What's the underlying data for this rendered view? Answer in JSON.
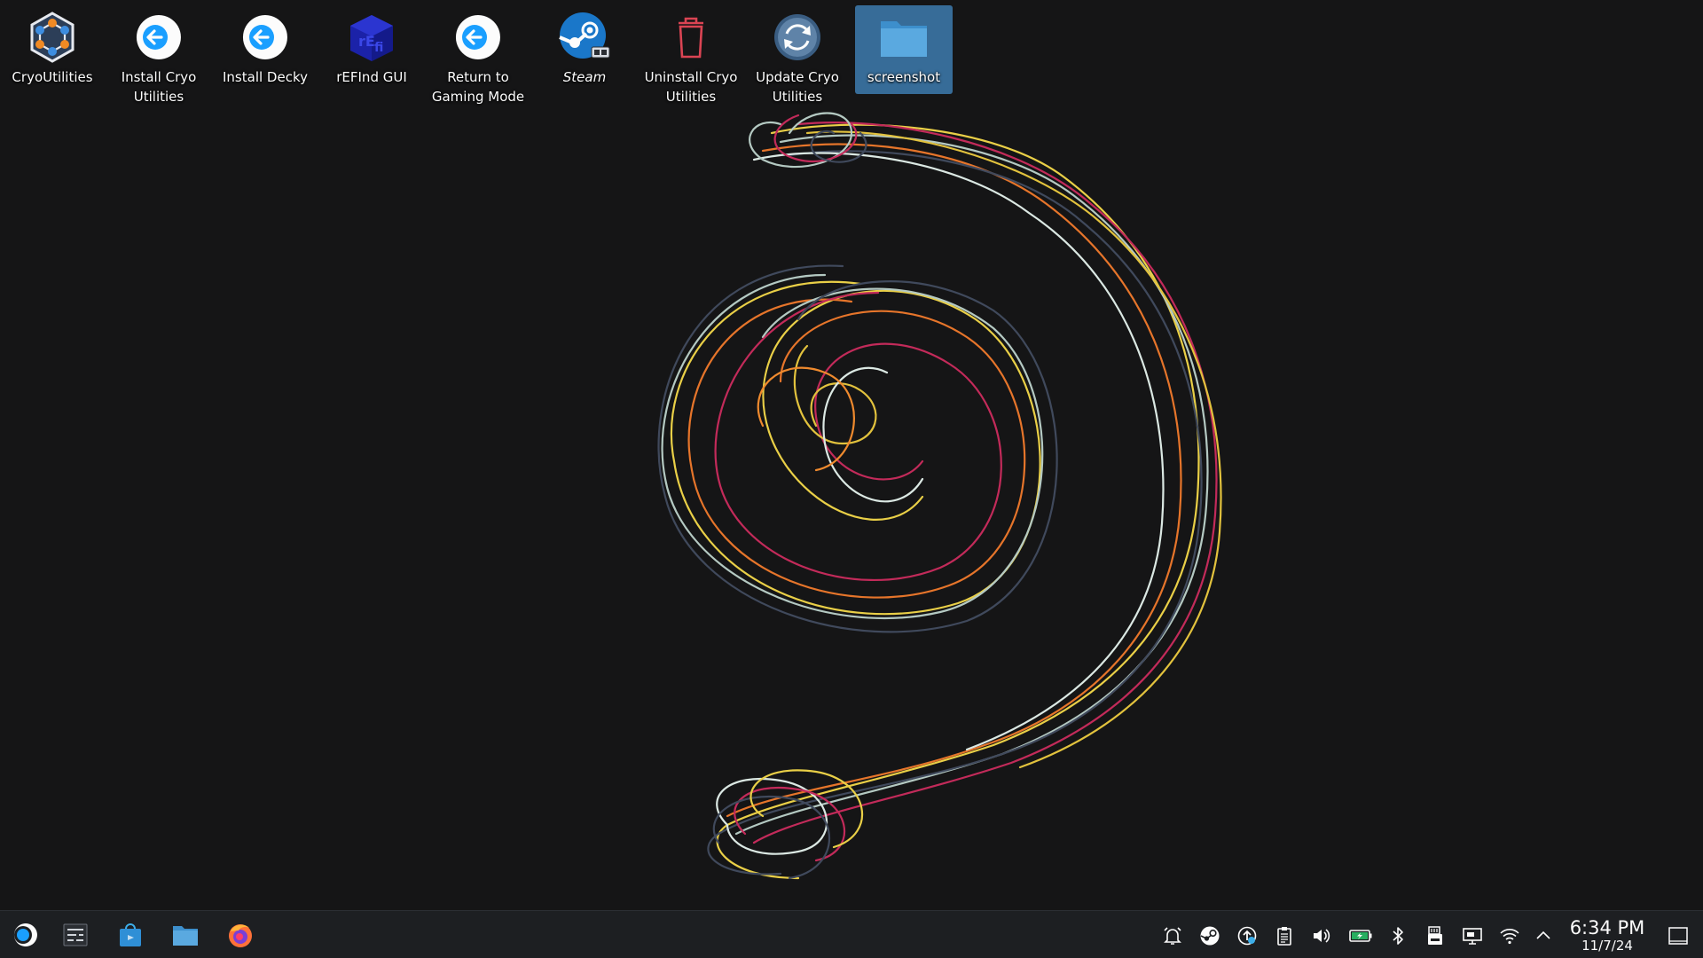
{
  "desktop": {
    "icons": [
      {
        "label": "CryoUtilities",
        "icon": "cryoutilities-icon"
      },
      {
        "label": "Install Cryo Utilities",
        "icon": "install-arrow-icon"
      },
      {
        "label": "Install Decky",
        "icon": "install-arrow-icon"
      },
      {
        "label": "rEFInd GUI",
        "icon": "refind-cube-icon"
      },
      {
        "label": "Return to Gaming Mode",
        "icon": "return-arrow-icon"
      },
      {
        "label": "Steam",
        "icon": "steam-icon"
      },
      {
        "label": "Uninstall Cryo Utilities",
        "icon": "trash-icon"
      },
      {
        "label": "Update Cryo Utilities",
        "icon": "update-icon"
      },
      {
        "label": "screenshot",
        "icon": "folder-icon",
        "selected": true
      }
    ]
  },
  "taskbar": {
    "launchers": [
      "application-launcher-icon",
      "task-switcher-icon",
      "discover-store-icon",
      "file-manager-icon",
      "firefox-icon"
    ],
    "tray": [
      "notifications-icon",
      "steam-tray-icon",
      "update-tray-icon",
      "clipboard-icon",
      "volume-icon",
      "battery-icon",
      "bluetooth-icon",
      "storage-device-icon",
      "display-icon",
      "wifi-icon",
      "expand-tray-icon"
    ],
    "clock": {
      "time": "6:34 PM",
      "date": "11/7/24"
    }
  },
  "colors": {
    "desktop_background": "#151516",
    "taskbar_background": "#1d1f22",
    "selection": "#3d7baf",
    "accent": "#3daee9"
  }
}
